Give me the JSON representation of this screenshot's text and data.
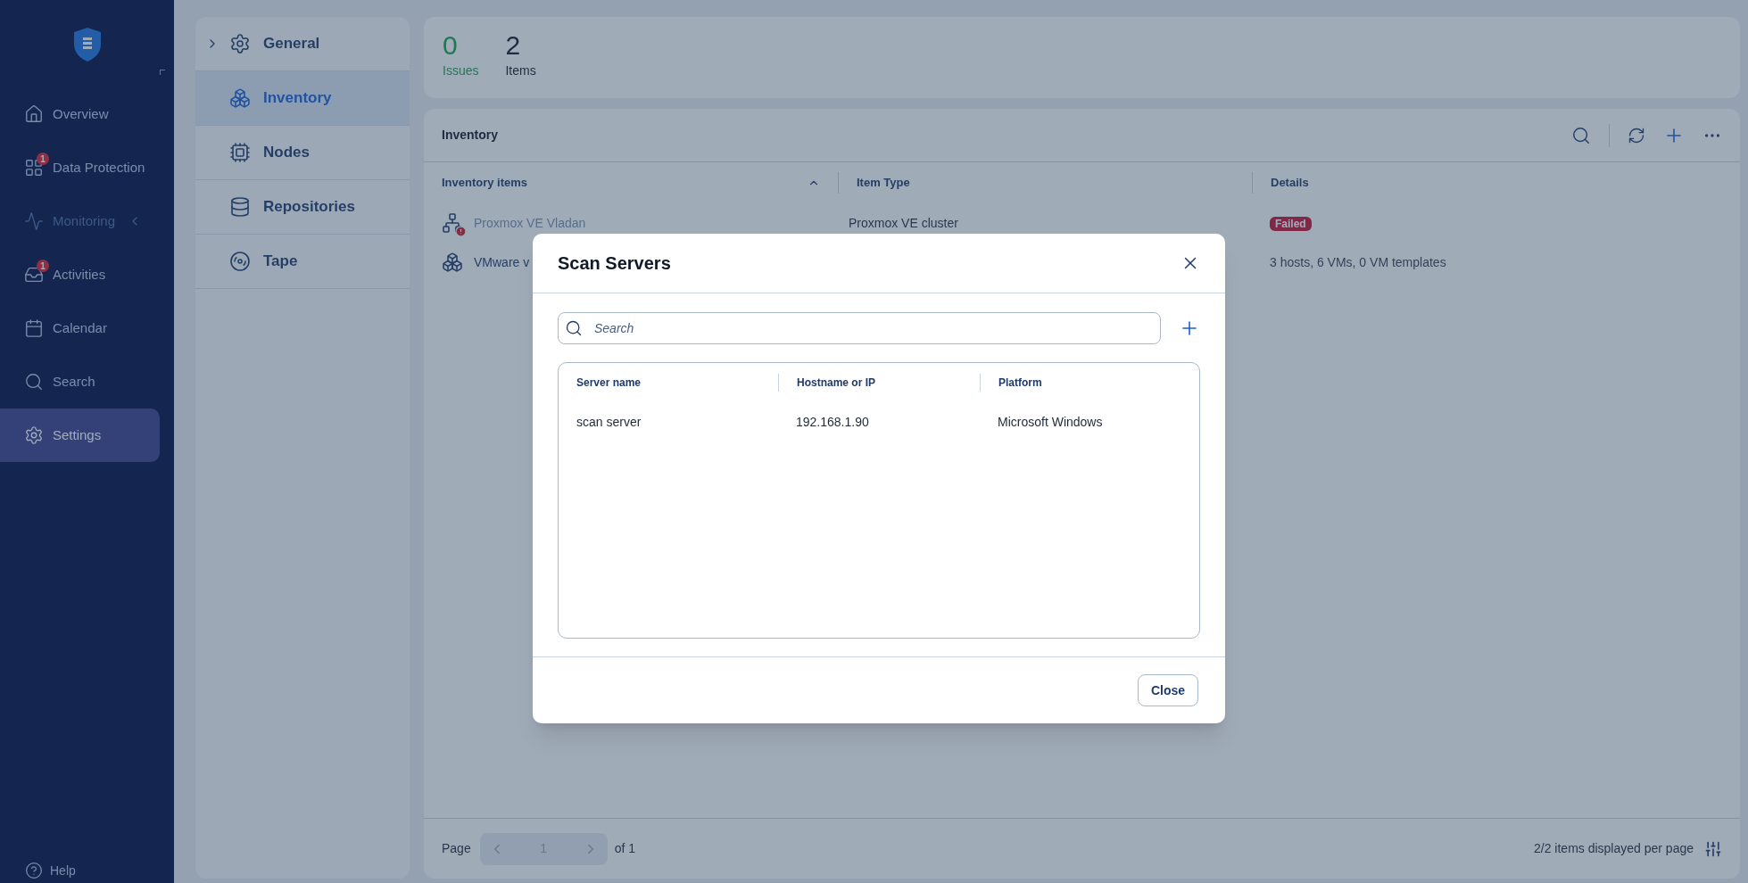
{
  "sidebar": {
    "items": [
      {
        "label": "Overview",
        "disabled": false,
        "selected": false,
        "has_submenu": false
      },
      {
        "label": "Data Protection",
        "badge": "1",
        "disabled": false,
        "selected": false,
        "has_submenu": false
      },
      {
        "label": "Monitoring",
        "disabled": true,
        "selected": false,
        "has_submenu": true
      },
      {
        "label": "Activities",
        "badge": "1",
        "disabled": false,
        "selected": false,
        "has_submenu": false
      },
      {
        "label": "Calendar",
        "disabled": false,
        "selected": false,
        "has_submenu": false
      },
      {
        "label": "Search",
        "disabled": false,
        "selected": false,
        "has_submenu": false
      },
      {
        "label": "Settings",
        "disabled": false,
        "selected": true,
        "has_submenu": false
      }
    ],
    "help": "Help"
  },
  "settings_menu": [
    {
      "label": "General",
      "expandable": true,
      "selected": false
    },
    {
      "label": "Inventory",
      "expandable": false,
      "selected": true
    },
    {
      "label": "Nodes",
      "expandable": false,
      "selected": false
    },
    {
      "label": "Repositories",
      "expandable": false,
      "selected": false
    },
    {
      "label": "Tape",
      "expandable": false,
      "selected": false
    }
  ],
  "summary": [
    {
      "value": "0",
      "label": "Issues",
      "kind": "issues"
    },
    {
      "value": "2",
      "label": "Items",
      "kind": "count"
    }
  ],
  "inventory": {
    "title": "Inventory",
    "columns": [
      {
        "label": "Inventory items",
        "sorted": true
      },
      {
        "label": "Item Type"
      },
      {
        "label": "Details"
      }
    ],
    "rows": [
      {
        "name": "Proxmox VE Vladan",
        "kind": "failed",
        "error": true,
        "disabled": true,
        "type": "Proxmox VE cluster",
        "details": "Failed"
      },
      {
        "name": "VMware v",
        "kind": "ok",
        "error": false,
        "disabled": false,
        "details": "3 hosts, 6 VMs, 0 VM templates"
      }
    ],
    "pager": {
      "label": "Page",
      "page": "1",
      "of": "of 1"
    },
    "per_page": "2/2 items displayed per page"
  },
  "dialog": {
    "title": "Scan Servers",
    "search": {
      "placeholder": "Search"
    },
    "columns": [
      "Server name",
      "Hostname or IP",
      "Platform"
    ],
    "rows": [
      [
        "scan server",
        "192.168.1.90",
        "Microsoft Windows"
      ]
    ],
    "button": "Close"
  }
}
